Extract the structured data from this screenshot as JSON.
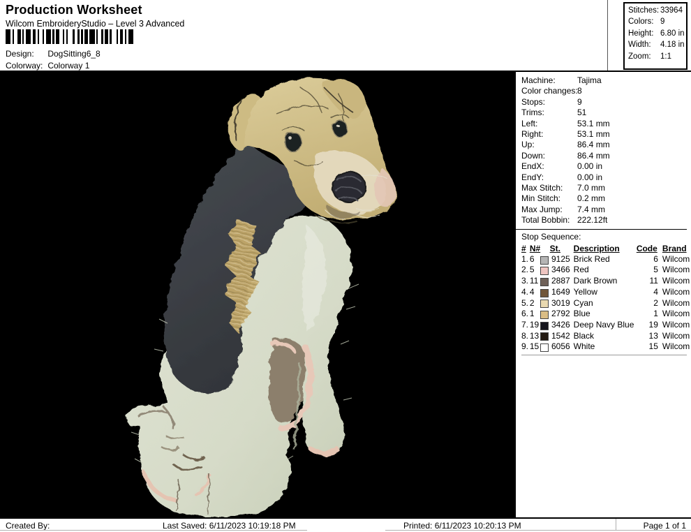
{
  "header": {
    "title": "Production Worksheet",
    "subtitle": "Wilcom EmbroideryStudio – Level 3 Advanced",
    "design_label": "Design:",
    "design_value": "DogSitting6_8",
    "colorway_label": "Colorway:",
    "colorway_value": "Colorway 1",
    "stats": [
      {
        "label": "Stitches:",
        "value": "33964"
      },
      {
        "label": "Colors:",
        "value": "9"
      },
      {
        "label": "Height:",
        "value": "6.80 in"
      },
      {
        "label": "Width:",
        "value": "4.18 in"
      },
      {
        "label": "Zoom:",
        "value": "1:1"
      }
    ]
  },
  "canvas": {
    "background": "#000000"
  },
  "machine_details": [
    {
      "label": "Machine:",
      "value": "Tajima"
    },
    {
      "label": "Color changes:",
      "value": "8"
    },
    {
      "label": "Stops:",
      "value": "9"
    },
    {
      "label": "Trims:",
      "value": "51"
    },
    {
      "label": "Left:",
      "value": "53.1 mm"
    },
    {
      "label": "Right:",
      "value": "53.1 mm"
    },
    {
      "label": "Up:",
      "value": "86.4 mm"
    },
    {
      "label": "Down:",
      "value": "86.4 mm"
    },
    {
      "label": "EndX:",
      "value": "0.00 in"
    },
    {
      "label": "EndY:",
      "value": "0.00 in"
    },
    {
      "label": "Max Stitch:",
      "value": "7.0 mm"
    },
    {
      "label": "Min Stitch:",
      "value": "0.2 mm"
    },
    {
      "label": "Max Jump:",
      "value": "7.4 mm"
    },
    {
      "label": "Total Bobbin:",
      "value": "222.12ft"
    }
  ],
  "stop_sequence": {
    "title": "Stop Sequence:",
    "headers": {
      "num": "#",
      "n": "N#",
      "st": "St.",
      "description": "Description",
      "code": "Code",
      "brand": "Brand"
    },
    "rows": [
      {
        "num": "1.",
        "n": "6",
        "swatch": "#b5b5b5",
        "st": "9125",
        "description": "Brick Red",
        "code": "6",
        "brand": "Wilcom"
      },
      {
        "num": "2.",
        "n": "5",
        "swatch": "#efc5c1",
        "st": "3466",
        "description": "Red",
        "code": "5",
        "brand": "Wilcom"
      },
      {
        "num": "3.",
        "n": "11",
        "swatch": "#6f6159",
        "st": "2887",
        "description": "Dark Brown",
        "code": "11",
        "brand": "Wilcom"
      },
      {
        "num": "4.",
        "n": "4",
        "swatch": "#715639",
        "st": "1649",
        "description": "Yellow",
        "code": "4",
        "brand": "Wilcom"
      },
      {
        "num": "5.",
        "n": "2",
        "swatch": "#e9d9b0",
        "st": "3019",
        "description": "Cyan",
        "code": "2",
        "brand": "Wilcom"
      },
      {
        "num": "6.",
        "n": "1",
        "swatch": "#dabd85",
        "st": "2792",
        "description": "Blue",
        "code": "1",
        "brand": "Wilcom"
      },
      {
        "num": "7.",
        "n": "19",
        "swatch": "#15151d",
        "st": "3426",
        "description": "Deep Navy Blue",
        "code": "19",
        "brand": "Wilcom"
      },
      {
        "num": "8.",
        "n": "13",
        "swatch": "#221911",
        "st": "1542",
        "description": "Black",
        "code": "13",
        "brand": "Wilcom"
      },
      {
        "num": "9.",
        "n": "15",
        "swatch": "#ffffff",
        "st": "6056",
        "description": "White",
        "code": "15",
        "brand": "Wilcom"
      }
    ]
  },
  "footer": {
    "created_by": "Created By:",
    "last_saved": "Last Saved: 6/11/2023 10:19:18 PM",
    "printed": "Printed: 6/11/2023 10:20:13 PM",
    "page": "Page 1 of 1"
  }
}
